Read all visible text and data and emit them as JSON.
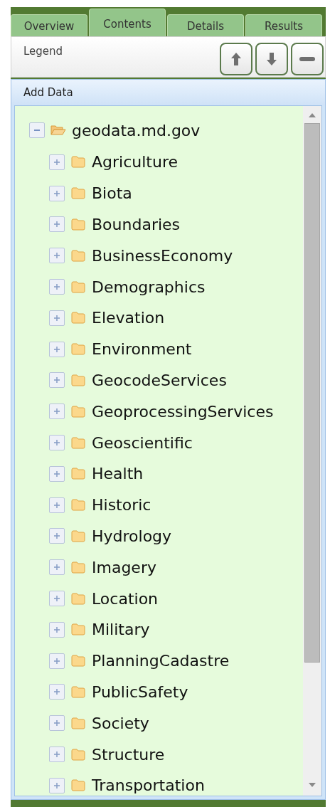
{
  "tabs": [
    {
      "label": "Overview",
      "selected": false
    },
    {
      "label": "Contents",
      "selected": true
    },
    {
      "label": "Details",
      "selected": false
    },
    {
      "label": "Results",
      "selected": false
    }
  ],
  "legend": {
    "title": "Legend",
    "buttons": [
      {
        "kind": "up"
      },
      {
        "kind": "down"
      },
      {
        "kind": "remove"
      }
    ]
  },
  "add_data": {
    "title": "Add Data"
  },
  "tree": [
    {
      "label": "geodata.md.gov",
      "expanded": true,
      "children": [
        {
          "label": "Agriculture",
          "expanded": false
        },
        {
          "label": "Biota",
          "expanded": false
        },
        {
          "label": "Boundaries",
          "expanded": false
        },
        {
          "label": "BusinessEconomy",
          "expanded": false
        },
        {
          "label": "Demographics",
          "expanded": false
        },
        {
          "label": "Elevation",
          "expanded": false
        },
        {
          "label": "Environment",
          "expanded": false
        },
        {
          "label": "GeocodeServices",
          "expanded": false
        },
        {
          "label": "GeoprocessingServices",
          "expanded": false
        },
        {
          "label": "Geoscientific",
          "expanded": false
        },
        {
          "label": "Health",
          "expanded": false
        },
        {
          "label": "Historic",
          "expanded": false
        },
        {
          "label": "Hydrology",
          "expanded": false
        },
        {
          "label": "Imagery",
          "expanded": false
        },
        {
          "label": "Location",
          "expanded": false
        },
        {
          "label": "Military",
          "expanded": false
        },
        {
          "label": "PlanningCadastre",
          "expanded": false
        },
        {
          "label": "PublicSafety",
          "expanded": false
        },
        {
          "label": "Society",
          "expanded": false
        },
        {
          "label": "Structure",
          "expanded": false
        },
        {
          "label": "Transportation",
          "expanded": false
        }
      ]
    }
  ]
}
